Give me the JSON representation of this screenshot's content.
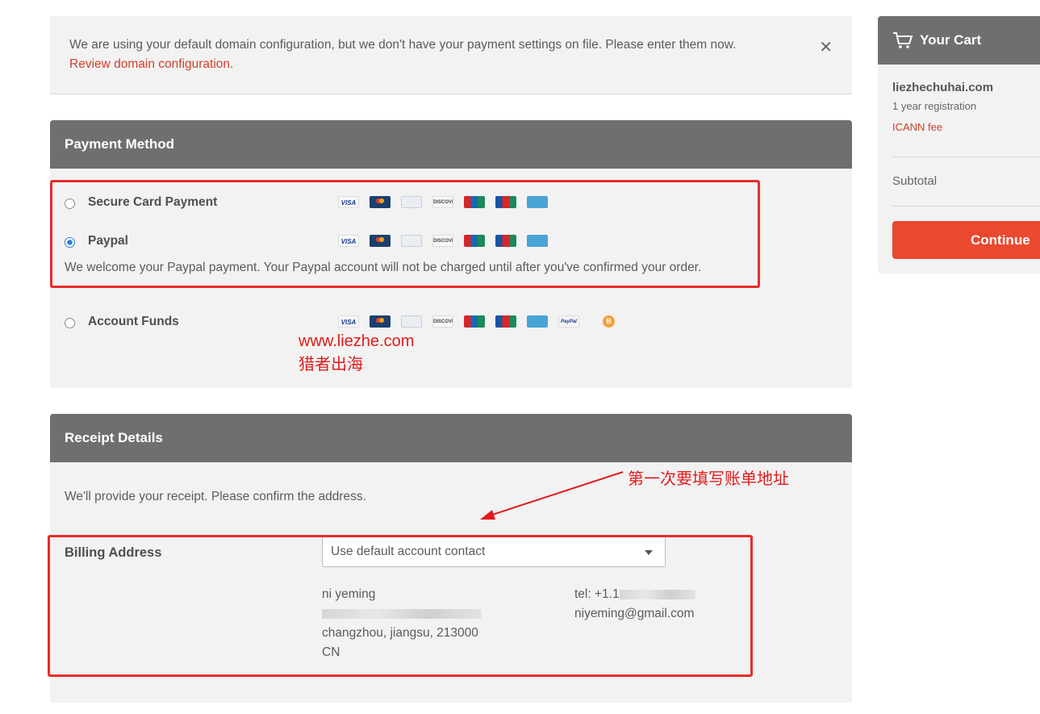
{
  "notice": {
    "text": "We are using your default domain configuration, but we don't have your payment settings on file. Please enter them now.",
    "link": "Review domain configuration",
    "link_suffix": ".",
    "close": "✕"
  },
  "payment": {
    "title": "Payment Method",
    "options": [
      {
        "label": "Secure Card Payment",
        "selected": false
      },
      {
        "label": "Paypal",
        "selected": true
      },
      {
        "label": "Account Funds",
        "selected": false
      }
    ],
    "card_icons": [
      "visa-icon",
      "mastercard-icon",
      "amex-icon",
      "discover-icon",
      "unionpay-icon",
      "jcb-icon",
      "paysafe-icon"
    ],
    "extra_icons": [
      "paypal-icon",
      "bitcoin-icon"
    ],
    "card_text": {
      "visa": "VISA",
      "discover": "DISCOVER",
      "paypal": "PayPal",
      "bitcoin": "B"
    },
    "paypal_description": "We welcome your Paypal payment. Your Paypal account will not be charged until after you've confirmed your order.",
    "watermark_line1": "www.liezhe.com",
    "watermark_line2": "猎者出海"
  },
  "receipt": {
    "title": "Receipt Details",
    "intro": "We'll provide your receipt. Please confirm the address.",
    "billing_label": "Billing Address",
    "select_value": "Use default account contact",
    "address": {
      "name": "ni yeming",
      "line2_prefix": "",
      "city": "changzhou, jiangsu, 213000",
      "country": "CN"
    },
    "contact": {
      "tel_prefix": "tel: +1.1",
      "email": "niyeming@gmail.com"
    },
    "annotation": "第一次要填写账单地址"
  },
  "cart": {
    "title": "Your Cart",
    "domain": "liezhechuhai.com",
    "registration": "1 year registration",
    "icann_fee": "ICANN fee",
    "subtotal_label": "Subtotal",
    "continue_label": "Continue"
  },
  "colors": {
    "accent_red": "#e8492f",
    "header_gray": "#6e6f71",
    "panel_bg": "#f2f2f2",
    "annotation_red": "#e21b1b",
    "link_red": "#d13f27",
    "radio_blue": "#2f7fd6"
  }
}
